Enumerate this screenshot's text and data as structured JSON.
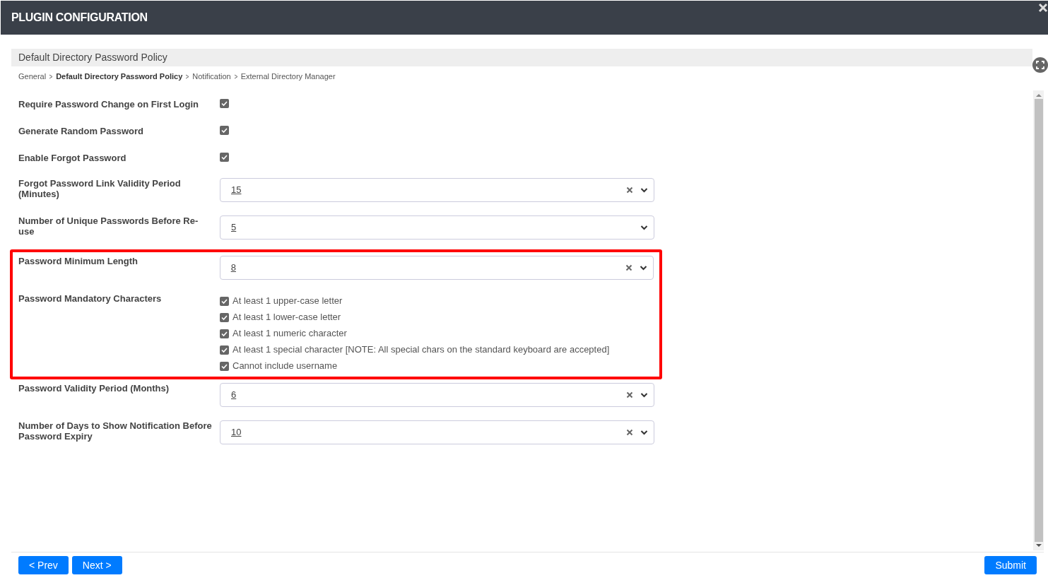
{
  "window": {
    "title": "PLUGIN CONFIGURATION"
  },
  "section": {
    "title": "Default Directory Password Policy"
  },
  "breadcrumb": [
    {
      "label": "General",
      "current": false
    },
    {
      "label": "Default Directory Password Policy",
      "current": true
    },
    {
      "label": "Notification",
      "current": false
    },
    {
      "label": "External Directory Manager",
      "current": false
    }
  ],
  "fields": [
    {
      "kind": "checkbox",
      "label": "Require Password Change on First Login",
      "checked": true,
      "highlighted": false
    },
    {
      "kind": "checkbox",
      "label": "Generate Random Password",
      "checked": true,
      "highlighted": false
    },
    {
      "kind": "checkbox",
      "label": "Enable Forgot Password",
      "checked": true,
      "highlighted": false
    },
    {
      "kind": "select",
      "label": "Forgot Password Link Validity Period (Minutes)",
      "value": "15",
      "clearable": true,
      "highlighted": false
    },
    {
      "kind": "select",
      "label": "Number of Unique Passwords Before Re-use",
      "value": "5",
      "clearable": false,
      "highlighted": false
    },
    {
      "kind": "select",
      "label": "Password Minimum Length",
      "value": "8",
      "clearable": true,
      "highlighted": true
    },
    {
      "kind": "checklist",
      "label": "Password Mandatory Characters",
      "highlighted": true,
      "options": [
        {
          "label": "At least 1 upper-case letter",
          "checked": true
        },
        {
          "label": "At least 1 lower-case letter",
          "checked": true
        },
        {
          "label": "At least 1 numeric character",
          "checked": true
        },
        {
          "label": "At least 1 special character [NOTE: All special chars on the standard keyboard are accepted]",
          "checked": true
        },
        {
          "label": "Cannot include username",
          "checked": true
        }
      ]
    },
    {
      "kind": "select",
      "label": "Password Validity Period (Months)",
      "value": "6",
      "clearable": true,
      "highlighted": false
    },
    {
      "kind": "select",
      "label": "Number of Days to Show Notification Before Password Expiry",
      "value": "10",
      "clearable": true,
      "highlighted": false
    }
  ],
  "footer": {
    "prev": "< Prev",
    "next": "Next >",
    "submit": "Submit"
  }
}
